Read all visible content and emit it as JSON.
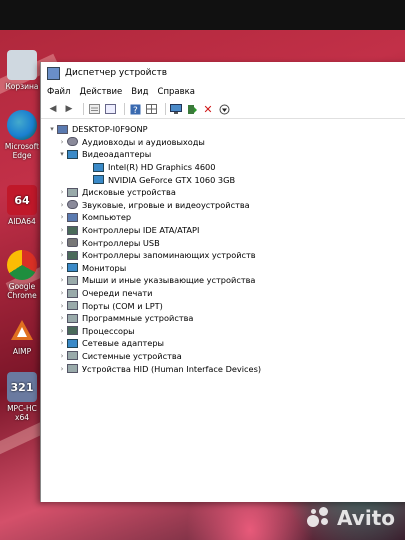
{
  "desktop": {
    "icons": [
      {
        "label": "Корзина",
        "icon": "recycle-bin-icon",
        "color": "#cfd8e0"
      },
      {
        "label": "Microsoft Edge",
        "icon": "edge-icon",
        "color": "#1a7fd0"
      },
      {
        "label": "AIDA64",
        "icon": "aida64-icon",
        "color": "#c0182a",
        "glyph": "64"
      },
      {
        "label": "Google Chrome",
        "icon": "chrome-icon",
        "color": "#e0b020"
      },
      {
        "label": "AIMP",
        "icon": "aimp-icon",
        "color": "#e07020"
      },
      {
        "label": "MPC-HC x64",
        "icon": "mpc-hc-icon",
        "color": "#6a7aa0",
        "glyph": "321"
      }
    ]
  },
  "window": {
    "title": "Диспетчер устройств",
    "menu": [
      "Файл",
      "Действие",
      "Вид",
      "Справка"
    ],
    "toolbar": [
      "back-icon",
      "forward-icon",
      "properties-icon",
      "show-hide-icon",
      "help-icon",
      "grid-icon",
      "scan-hardware-icon",
      "update-driver-icon",
      "uninstall-icon",
      "download-icon"
    ]
  },
  "tree": {
    "root": "DESKTOP-I0F9ONP",
    "items": [
      {
        "label": "Аудиовходы и аудиовыходы",
        "icon": "snd",
        "expanded": false,
        "level": 1
      },
      {
        "label": "Видеоадаптеры",
        "icon": "mon",
        "expanded": true,
        "level": 1
      },
      {
        "label": "Intel(R) HD Graphics 4600",
        "icon": "mon",
        "level": 2
      },
      {
        "label": "NVIDIA GeForce GTX 1060 3GB",
        "icon": "mon",
        "level": 2
      },
      {
        "label": "Дисковые устройства",
        "icon": "gray",
        "expanded": false,
        "level": 1
      },
      {
        "label": "Звуковые, игровые и видеоустройства",
        "icon": "snd",
        "expanded": false,
        "level": 1
      },
      {
        "label": "Компьютер",
        "icon": "pc",
        "expanded": false,
        "level": 1
      },
      {
        "label": "Контроллеры IDE ATA/ATAPI",
        "icon": "chip",
        "expanded": false,
        "level": 1
      },
      {
        "label": "Контроллеры USB",
        "icon": "usb",
        "expanded": false,
        "level": 1
      },
      {
        "label": "Контроллеры запоминающих устройств",
        "icon": "chip",
        "expanded": false,
        "level": 1
      },
      {
        "label": "Мониторы",
        "icon": "mon",
        "expanded": false,
        "level": 1
      },
      {
        "label": "Мыши и иные указывающие устройства",
        "icon": "gray",
        "expanded": false,
        "level": 1
      },
      {
        "label": "Очереди печати",
        "icon": "gray",
        "expanded": false,
        "level": 1
      },
      {
        "label": "Порты (COM и LPT)",
        "icon": "gray",
        "expanded": false,
        "level": 1
      },
      {
        "label": "Программные устройства",
        "icon": "gray",
        "expanded": false,
        "level": 1
      },
      {
        "label": "Процессоры",
        "icon": "chip",
        "expanded": false,
        "level": 1
      },
      {
        "label": "Сетевые адаптеры",
        "icon": "mon",
        "expanded": false,
        "level": 1
      },
      {
        "label": "Системные устройства",
        "icon": "gray",
        "expanded": false,
        "level": 1
      },
      {
        "label": "Устройства HID (Human Interface Devices)",
        "icon": "gray",
        "expanded": false,
        "level": 1
      }
    ]
  },
  "watermark": {
    "text": "Avito"
  }
}
